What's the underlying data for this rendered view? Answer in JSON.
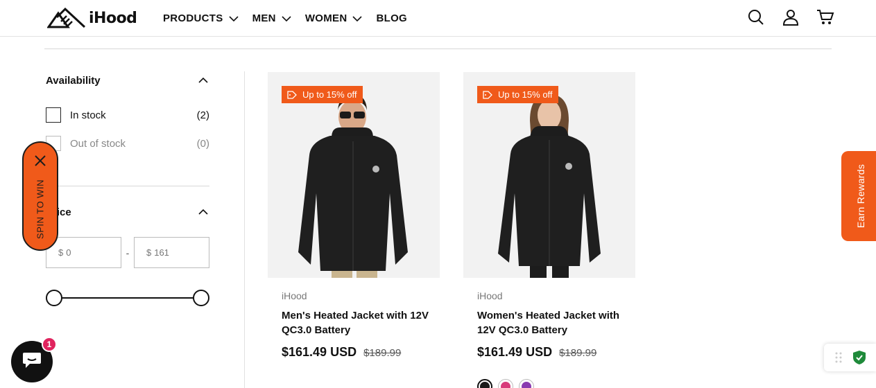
{
  "header": {
    "logo_text": "iHood",
    "nav": [
      {
        "label": "PRODUCTS",
        "has_dropdown": true
      },
      {
        "label": "MEN",
        "has_dropdown": true
      },
      {
        "label": "WOMEN",
        "has_dropdown": true
      },
      {
        "label": "BLOG",
        "has_dropdown": false
      }
    ],
    "icons": [
      "search-icon",
      "account-icon",
      "cart-icon"
    ]
  },
  "filters": {
    "availability": {
      "title": "Availability",
      "options": [
        {
          "label": "In stock",
          "count": "(2)"
        },
        {
          "label": "Out of stock",
          "count": "(0)"
        }
      ]
    },
    "price": {
      "title": "Price",
      "currency": "$",
      "min_placeholder": "0",
      "max_placeholder": "161",
      "separator": "-",
      "slider_min_fraction": 0,
      "slider_max_fraction": 1
    }
  },
  "spin_widget": {
    "label": "SPIN TO WIN"
  },
  "products": [
    {
      "badge": "Up to 15% off",
      "vendor": "iHood",
      "title": "Men's Heated Jacket with 12V QC3.0 Battery",
      "price": "$161.49 USD",
      "compare_price": "$189.99"
    },
    {
      "badge": "Up to 15% off",
      "vendor": "iHood",
      "title": "Women's Heated Jacket with 12V QC3.0 Battery",
      "price": "$161.49 USD",
      "compare_price": "$189.99",
      "swatches": [
        "#1a1a1a",
        "#d83a7a",
        "#8a3ab0"
      ]
    }
  ],
  "rewards": {
    "label": "Earn Rewards"
  },
  "chat": {
    "badge_count": "1"
  },
  "colors": {
    "accent": "#f05a1a",
    "badge_red": "#e0245e",
    "shield_green": "#1f8a3a"
  }
}
